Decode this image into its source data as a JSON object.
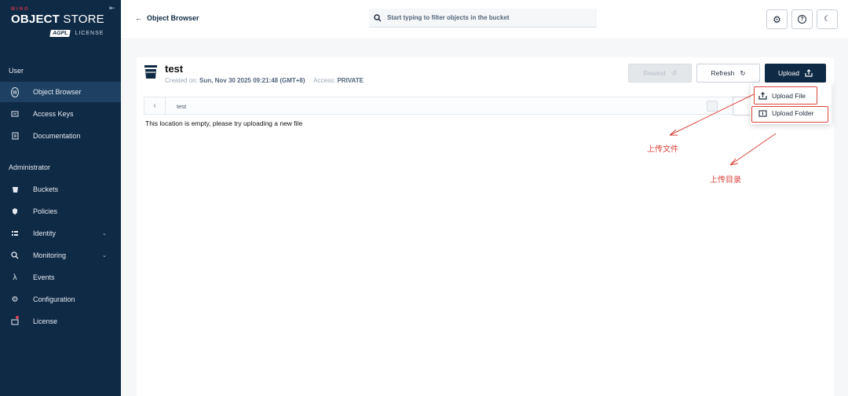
{
  "brand": {
    "min": "MINO",
    "object": "OBJECT",
    "store": "STORE",
    "agpl": "AGPL",
    "license": "LICENSE"
  },
  "sidebar": {
    "sections": [
      {
        "title": "User"
      },
      {
        "title": "Administrator"
      }
    ],
    "items": [
      {
        "label": "Object Browser",
        "icon": "object-browser-icon",
        "active": true
      },
      {
        "label": "Access Keys",
        "icon": "key-icon"
      },
      {
        "label": "Documentation",
        "icon": "document-icon"
      },
      {
        "label": "Buckets",
        "icon": "bucket-icon"
      },
      {
        "label": "Policies",
        "icon": "shield-icon"
      },
      {
        "label": "Identity",
        "icon": "identity-icon",
        "expandable": true
      },
      {
        "label": "Monitoring",
        "icon": "monitoring-icon",
        "expandable": true
      },
      {
        "label": "Events",
        "icon": "lambda-icon"
      },
      {
        "label": "Configuration",
        "icon": "gear-icon"
      },
      {
        "label": "License",
        "icon": "license-icon"
      }
    ]
  },
  "header": {
    "back_label": "Object Browser",
    "search_placeholder": "Start typing to filter objects in the bucket"
  },
  "bucket": {
    "name": "test",
    "created_label": "Created on:",
    "created_value": "Sun, Nov 30 2025 09:21:48 (GMT+8)",
    "access_label": "Access:",
    "access_value": "PRIVATE"
  },
  "actions": {
    "rewind": "Rewind",
    "refresh": "Refresh",
    "upload": "Upload"
  },
  "path": {
    "current": "test"
  },
  "empty_message": "This location is empty, please try uploading a new file",
  "upload_menu": {
    "file": "Upload File",
    "folder": "Upload Folder"
  },
  "annotations": {
    "file": "上传文件",
    "folder": "上传目录"
  },
  "colors": {
    "sidebar": "#0f2a45",
    "accent": "#c9344a",
    "annotation": "#d9453e"
  }
}
